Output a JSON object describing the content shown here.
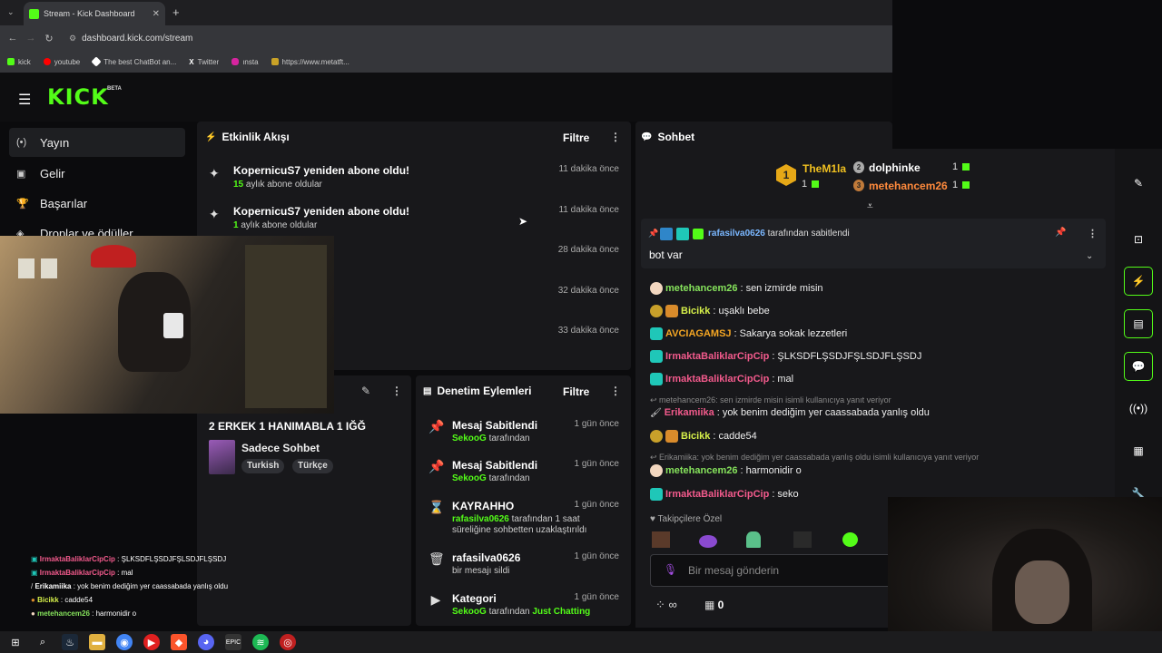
{
  "browser": {
    "tab_title": "Stream - Kick Dashboard",
    "url": "dashboard.kick.com/stream",
    "bookmarks": [
      "kick",
      "youtube",
      "The best ChatBot an...",
      "Twitter",
      "ınsta",
      "https://www.metatft..."
    ]
  },
  "header": {
    "logo": "KICK",
    "beta": "BETA"
  },
  "sidebar": {
    "items": [
      {
        "label": "Yayın",
        "icon": "broadcast-icon"
      },
      {
        "label": "Gelir",
        "icon": "revenue-icon"
      },
      {
        "label": "Başarılar",
        "icon": "trophy-icon"
      },
      {
        "label": "Droplar ve ödüller",
        "icon": "gift-icon"
      }
    ]
  },
  "activity": {
    "title": "Etkinlik Akışı",
    "filter_label": "Filtre",
    "events": [
      {
        "title": "KopernicuS7 yeniden abone oldu!",
        "count": "15",
        "detail": "aylık abone oldular",
        "time": "11 dakika önce"
      },
      {
        "title": "KopernicuS7 yeniden abone oldu!",
        "count": "1",
        "detail": "aylık abone oldular",
        "time": "11 dakika önce"
      },
      {
        "title": "",
        "count": "",
        "detail": "",
        "time": "28 dakika önce"
      },
      {
        "title": "",
        "count": "",
        "detail": "",
        "time": "32 dakika önce"
      },
      {
        "title": "",
        "count": "",
        "detail": "",
        "time": "33 dakika önce"
      }
    ]
  },
  "stream_info": {
    "title": "2 ERKEK 1 HANIMABLA 1 IĞĞ",
    "category": "Sadece Sohbet",
    "tags": [
      "Turkish",
      "Türkçe"
    ]
  },
  "moderation": {
    "title": "Denetim Eylemleri",
    "filter_label": "Filtre",
    "actions": [
      {
        "title": "Mesaj Sabitlendi",
        "user": "SekooG",
        "text": "tarafından",
        "extra": "",
        "time": "1 gün önce"
      },
      {
        "title": "Mesaj Sabitlendi",
        "user": "SekooG",
        "text": "tarafından",
        "extra": "",
        "time": "1 gün önce"
      },
      {
        "title": "KAYRAHHO",
        "user": "rafasilva0626",
        "text": "tarafından 1 saat süreliğine sohbetten uzaklaştırıldı",
        "extra": "",
        "time": "1 gün önce"
      },
      {
        "title": "rafasilva0626",
        "user": "",
        "text": "bir mesajı sildi",
        "extra": "",
        "time": "1 gün önce"
      },
      {
        "title": "Kategori",
        "user": "SekooG",
        "text": "tarafından",
        "extra": "Just Chatting",
        "time": "1 gün önce"
      }
    ]
  },
  "chat": {
    "title": "Sohbet",
    "leaderboard": [
      {
        "rank": "1",
        "name": "TheM1la",
        "count": "1"
      },
      {
        "rank": "2",
        "name": "dolphinke",
        "count": "1"
      },
      {
        "rank": "3",
        "name": "metehancem26",
        "count": "1"
      }
    ],
    "pinned": {
      "by_user": "rafasilva0626",
      "by_text": "tarafından sabitlendi",
      "message": "bot var"
    },
    "messages": [
      {
        "user": "metehancem26",
        "text": "sen izmirde misin",
        "color": "#86e35c"
      },
      {
        "user": "Bicikk",
        "text": "uşaklı bebe",
        "color": "#d6f04a"
      },
      {
        "user": "AVCIAGAMSJ",
        "text": "Sakarya sokak lezzetleri",
        "color": "#f5a623"
      },
      {
        "user": "IrmaktaBaliklarCipCip",
        "text": "ŞLKSDFLŞSDJFŞLSDJFLŞSDJ",
        "color": "#f25a8c"
      },
      {
        "user": "IrmaktaBaliklarCipCip",
        "text": "mal",
        "color": "#f25a8c"
      },
      {
        "user": "Erikamiika",
        "text": "yok benim dediğim yer caassabada yanlış oldu",
        "color": "#f25a8c"
      },
      {
        "user": "Bicikk",
        "text": "cadde54",
        "color": "#d6f04a"
      },
      {
        "user": "metehancem26",
        "text": "harmonidir o",
        "color": "#86e35c"
      },
      {
        "user": "IrmaktaBaliklarCipCip",
        "text": "seko",
        "color": "#f25a8c"
      }
    ],
    "replies": [
      "metehancem26: sen izmirde misin isimli kullanıcıya yanıt veriyor",
      "Erikamiika: yok benim dediğim yer caassabada yanlış oldu isimli kullanıcıya yanıt veriyor"
    ],
    "followers_only": "Takipçilere Özel",
    "input_placeholder": "Bir mesaj gönderin",
    "infinity": "∞",
    "gift_count": "0"
  },
  "overlay": [
    {
      "user": "IrmaktaBaliklarCipCip",
      "text": ": ŞLKSDFLŞSDJFŞLSDJFLŞSDJ",
      "color": "#f25a8c"
    },
    {
      "user": "IrmaktaBaliklarCipCip",
      "text": ": mal",
      "color": "#f25a8c"
    },
    {
      "user": "Erikamiika",
      "text": ": yok benim dediğim yer caassabada yanlış oldu",
      "color": "#fff"
    },
    {
      "user": "Bicikk",
      "text": ": cadde54",
      "color": "#d6f04a"
    },
    {
      "user": "metehancem26",
      "text": ": harmonidir o",
      "color": "#86e35c"
    }
  ]
}
